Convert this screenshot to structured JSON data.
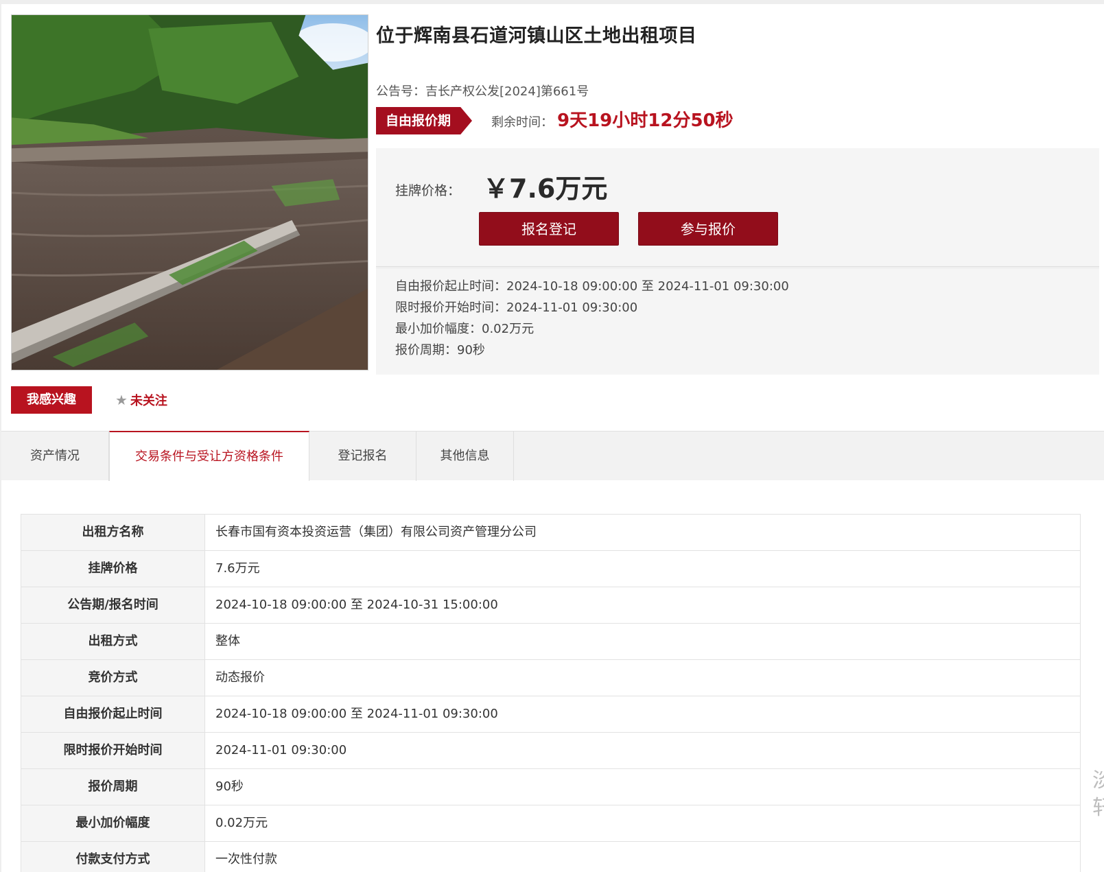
{
  "product": {
    "photo_alt": "",
    "title": "位于辉南县石道河镇山区土地出租项目",
    "notice_label": "公告号：",
    "notice_value": "吉长产权公发[2024]第661号"
  },
  "phase": {
    "tag": "自由报价期",
    "remain_label": "剩余时间：",
    "remain_value": "9天19小时12分50秒"
  },
  "price": {
    "label": "挂牌价格：",
    "value": "￥7.6万元",
    "register_button": "报名登记",
    "bid_button": "参与报价"
  },
  "timings": [
    "自由报价起止时间：2024-10-18 09:00:00 至 2024-11-01 09:30:00",
    "限时报价开始时间：2024-11-01 09:30:00",
    "最小加价幅度：0.02万元",
    "报价周期：90秒"
  ],
  "actions": {
    "interest_button": "我感兴趣",
    "follow_label": "未关注"
  },
  "tabs": [
    {
      "label": "资产情况"
    },
    {
      "label": "交易条件与受让方资格条件"
    },
    {
      "label": "登记报名"
    },
    {
      "label": "其他信息"
    }
  ],
  "details": [
    {
      "label": "出租方名称",
      "value": "长春市国有资本投资运营（集团）有限公司资产管理分公司"
    },
    {
      "label": "挂牌价格",
      "value": "7.6万元"
    },
    {
      "label": "公告期/报名时间",
      "value": "2024-10-18 09:00:00 至 2024-10-31 15:00:00"
    },
    {
      "label": "出租方式",
      "value": "整体"
    },
    {
      "label": "竞价方式",
      "value": "动态报价"
    },
    {
      "label": "自由报价起止时间",
      "value": "2024-10-18 09:00:00 至 2024-11-01 09:30:00"
    },
    {
      "label": "限时报价开始时间",
      "value": "2024-11-01 09:30:00"
    },
    {
      "label": "报价周期",
      "value": "90秒"
    },
    {
      "label": "最小加价幅度",
      "value": "0.02万元"
    },
    {
      "label": "付款支付方式",
      "value": "一次性付款"
    }
  ],
  "edge_glyphs": "淡\n轩",
  "colors": {
    "brand_red": "#b8131f",
    "button_dark_red": "#920d1b",
    "panel_gray": "#f5f5f5"
  }
}
